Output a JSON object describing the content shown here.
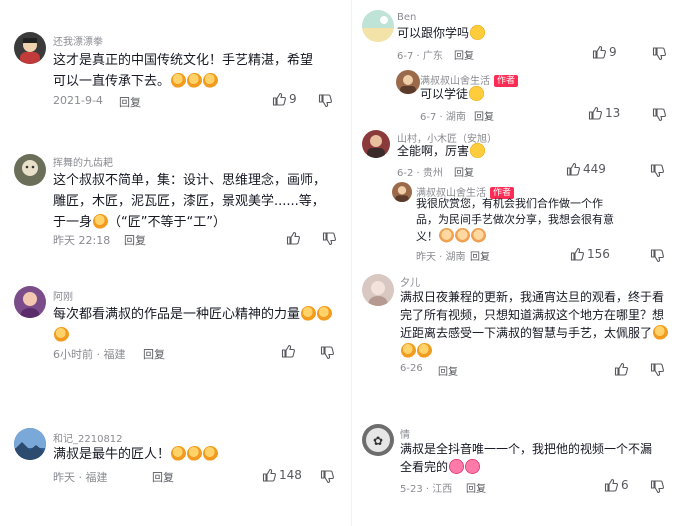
{
  "left": [
    {
      "username": "还我漂漂拳",
      "text": "这才是真正的中国传统文化！手艺精湛，希望可以一直传承下去。",
      "date": "2021-9-4",
      "reply": "回复",
      "likes": "9",
      "avatar": "#3b3b3b"
    },
    {
      "username": "挥舞的九齿耙",
      "text": "这个叔叔不简单，集：设计、思维理念，画师，雕匠，木匠，泥瓦匠，漆匠，景观美学......等，于一身",
      "text_tail": "（“匠”不等于“工”）",
      "date": "昨天 22:18",
      "reply": "回复",
      "likes": "",
      "avatar": "#6b6f5a"
    },
    {
      "username": "阿刚",
      "text": "每次都看满叔的作品是一种匠心精神的力量",
      "date": "6小时前 · 福建",
      "reply": "回复",
      "likes": "",
      "avatar": "#7a4d8a"
    },
    {
      "username": "和记_2210812",
      "text": "满叔是最牛的匠人！",
      "date": "昨天 · 福建",
      "reply": "回复",
      "likes": "148",
      "avatar": "#2e5f9a"
    }
  ],
  "right": [
    {
      "username": "Ben",
      "text": "可以跟你学吗",
      "date": "6-7 · 广东",
      "reply": "回复",
      "likes": "9",
      "avatar": "#bfe3d6"
    },
    {
      "username": "满叔叔山舍生活",
      "author_tag": "作者",
      "text": "可以学徒",
      "date": "6-7 · 湖南",
      "reply": "回复",
      "likes": "13",
      "avatar": "#9a6a4a"
    },
    {
      "username": "山村，小木匠（安旭）",
      "text": "全能啊，厉害",
      "date": "6-2 · 贵州",
      "reply": "回复",
      "likes": "449",
      "avatar": "#8a3a3a"
    },
    {
      "username": "满叔叔山舍生活",
      "author_tag": "作者",
      "text": "我很欣赏您，有机会我们合作做一个作品，为民间手艺做次分享，我想会很有意义！",
      "date": "昨天 · 湖南",
      "reply": "回复",
      "likes": "156",
      "avatar": "#9a6a4a"
    },
    {
      "username": "夕儿",
      "text": "满叔日夜兼程的更新，我通宵达旦的观看，终于看完了所有视频，只想知道满叔这个地方在哪里？想近距离去感受一下满叔的智慧与手艺，太佩服了",
      "date": "6-26",
      "reply": "回复",
      "likes": "",
      "avatar": "#d9c7c2"
    },
    {
      "username": "情",
      "text": "满叔是全抖音唯一一个，我把他的视频一个不漏全看完的",
      "date": "5-23 · 江西",
      "reply": "回复",
      "likes": "6",
      "avatar": "#6d6d6d"
    }
  ]
}
